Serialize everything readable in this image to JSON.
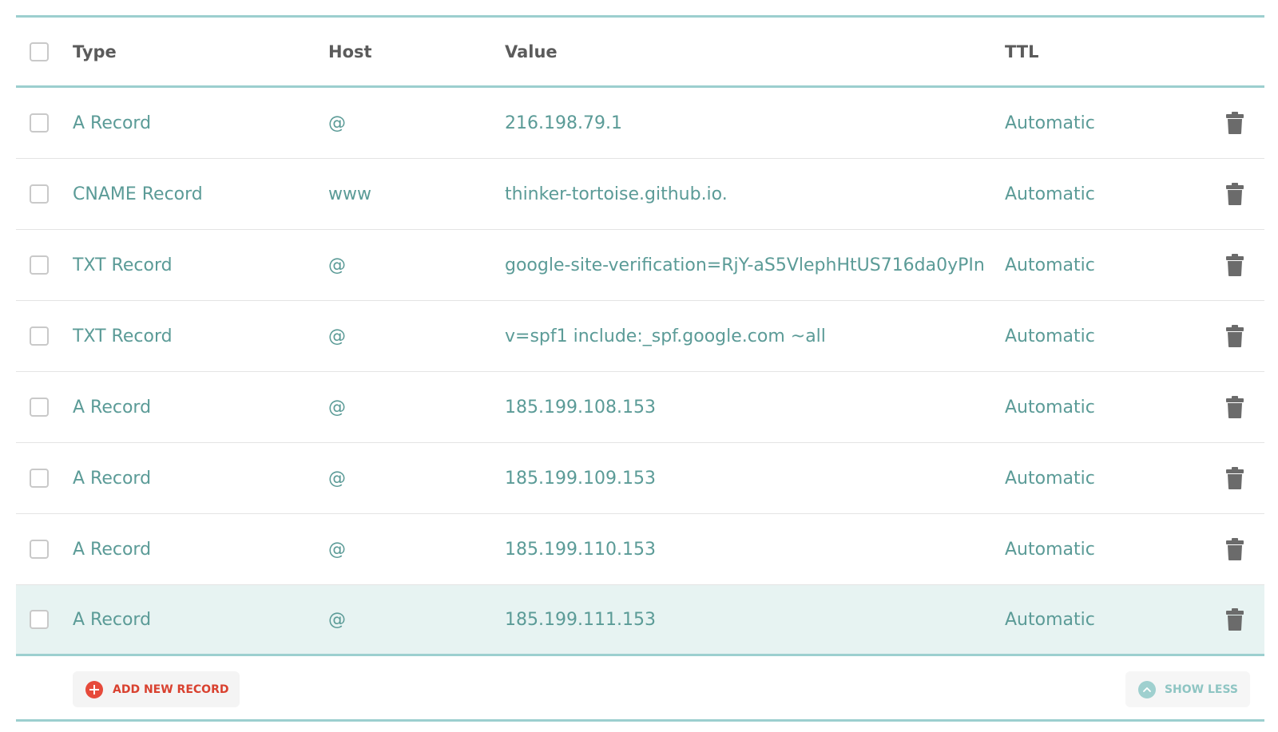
{
  "table": {
    "headers": {
      "type": "Type",
      "host": "Host",
      "value": "Value",
      "ttl": "TTL"
    },
    "records": [
      {
        "type": "A Record",
        "host": "@",
        "value": "216.198.79.1",
        "ttl": "Automatic"
      },
      {
        "type": "CNAME Record",
        "host": "www",
        "value": "thinker-tortoise.github.io.",
        "ttl": "Automatic"
      },
      {
        "type": "TXT Record",
        "host": "@",
        "value": "google-site-verification=RjY-aS5VlephHtUS716da0yPIn...",
        "ttl": "Automatic"
      },
      {
        "type": "TXT Record",
        "host": "@",
        "value": "v=spf1 include:_spf.google.com ~all",
        "ttl": "Automatic"
      },
      {
        "type": "A Record",
        "host": "@",
        "value": "185.199.108.153",
        "ttl": "Automatic"
      },
      {
        "type": "A Record",
        "host": "@",
        "value": "185.199.109.153",
        "ttl": "Automatic"
      },
      {
        "type": "A Record",
        "host": "@",
        "value": "185.199.110.153",
        "ttl": "Automatic"
      },
      {
        "type": "A Record",
        "host": "@",
        "value": "185.199.111.153",
        "ttl": "Automatic"
      }
    ],
    "highlighted_row_index": 7
  },
  "footer": {
    "add_label": "ADD NEW RECORD",
    "show_less_label": "SHOW LESS"
  },
  "icons": {
    "row_action": "trash-icon",
    "add": "plus-circle-icon",
    "collapse": "chevron-up-circle-icon"
  },
  "colors": {
    "accent": "#9ccfcf",
    "value_text": "#5b9b97",
    "header_text": "#5b5b5b",
    "add_red": "#e64a3b",
    "highlight_row": "#e7f3f2"
  }
}
